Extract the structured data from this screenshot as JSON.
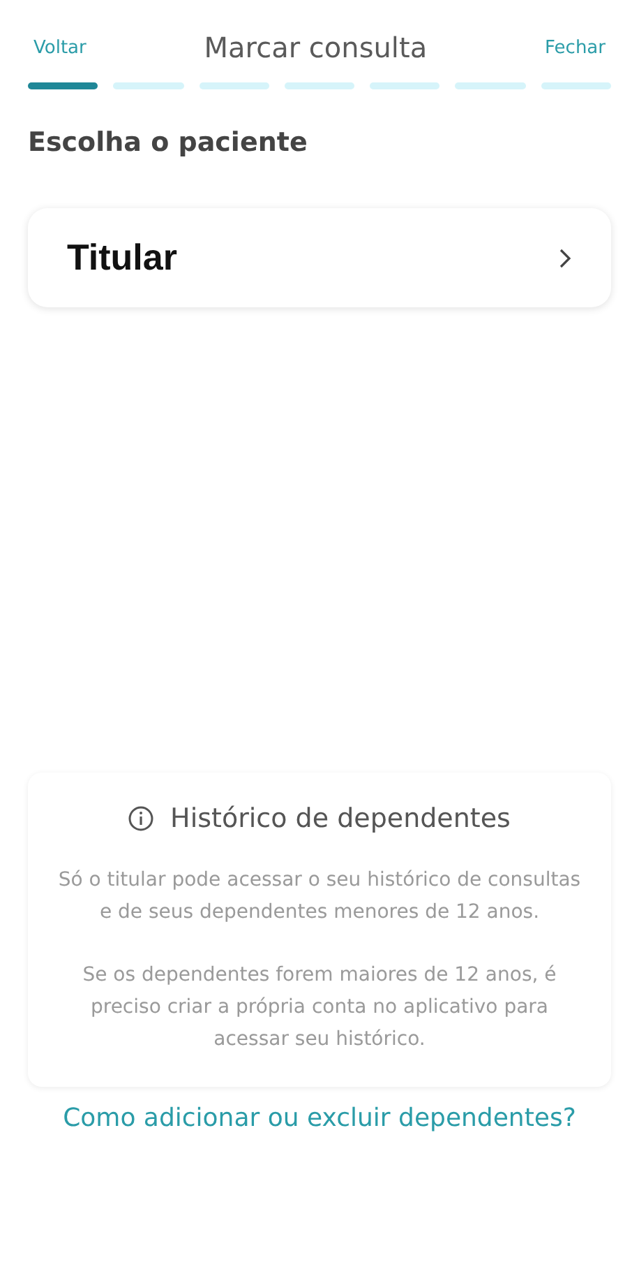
{
  "header": {
    "back": "Voltar",
    "title": "Marcar consulta",
    "close": "Fechar"
  },
  "steps": [
    {
      "selected": true
    },
    {
      "selected": false
    },
    {
      "selected": false
    },
    {
      "selected": false
    },
    {
      "selected": false
    },
    {
      "selected": false
    },
    {
      "selected": false
    }
  ],
  "section_title": "Escolha o paciente",
  "patients": [
    {
      "label": "Titular"
    }
  ],
  "info": {
    "title": "Histórico de dependentes",
    "paragraphs": [
      "Só o titular pode acessar o seu histórico de consultas e de seus dependentes menores de 12 anos.",
      "Se os dependentes forem maiores de 12 anos, é preciso criar a própria conta no aplicativo para acessar seu histórico."
    ]
  },
  "link": "Como adicionar ou excluir dependentes?"
}
